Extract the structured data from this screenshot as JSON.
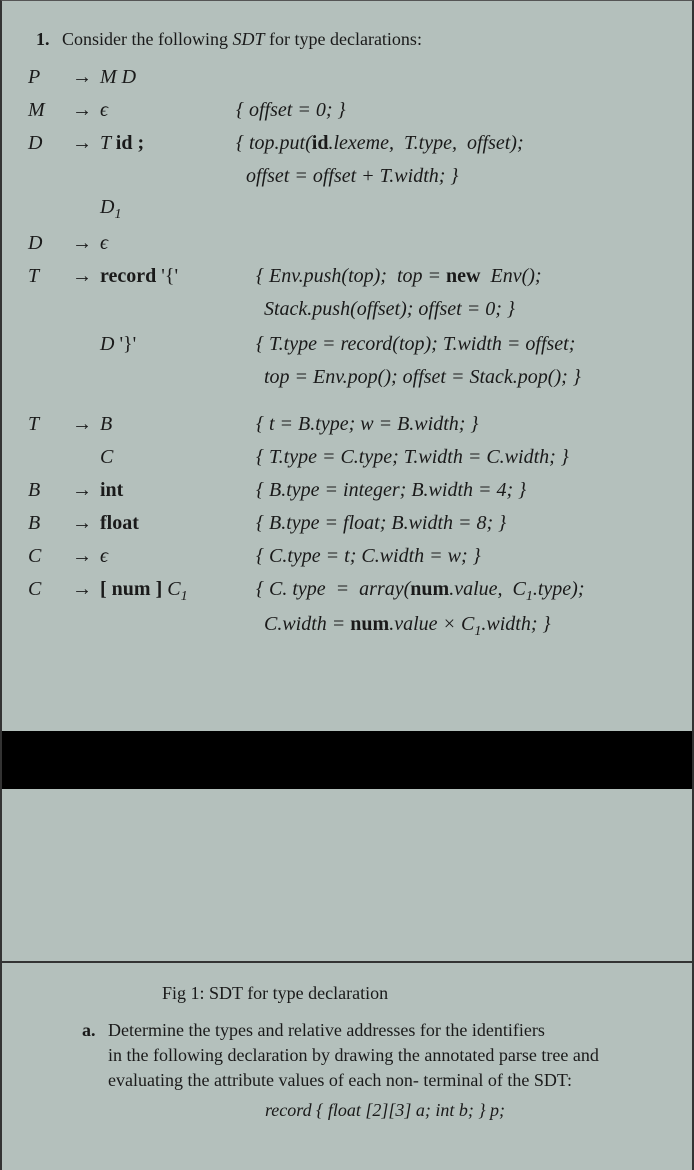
{
  "question": {
    "number": "1.",
    "text_before": "Consider the following ",
    "sdt": "SDT",
    "text_after": " for type declarations:"
  },
  "grammar": {
    "r1": {
      "lhs": "P",
      "arrow": "→",
      "rhs": "M D"
    },
    "r2": {
      "lhs": "M",
      "arrow": "→",
      "rhs": "ϵ",
      "act": "{ offset = 0; }"
    },
    "r3": {
      "lhs": "D",
      "arrow": "→",
      "rhs": "T id ;",
      "act": "{ top.put(id.lexeme,  T.type,  offset);"
    },
    "r3b": {
      "act": "offset  =  offset + T.width; }"
    },
    "r4": {
      "rhs": "D₁"
    },
    "r5": {
      "lhs": "D",
      "arrow": "→",
      "rhs": "ϵ"
    },
    "r6": {
      "lhs": "T",
      "arrow": "→",
      "rhs": "record '{'",
      "act": "{ Env.push(top);  top = new  Env();"
    },
    "r6b": {
      "act": "Stack.push(offset);  offset = 0; }"
    },
    "r7": {
      "rhs": "D '}'",
      "act": "{ T.type = record(top); T.width = offset;"
    },
    "r7b": {
      "act": "top = Env.pop(); offset = Stack.pop(); }"
    },
    "r8": {
      "lhs": "T",
      "arrow": "→",
      "rhs": "B",
      "act": "{ t = B.type; w = B.width; }"
    },
    "r9": {
      "rhs": "C",
      "act": "{ T.type = C.type; T.width = C.width; }"
    },
    "r10": {
      "lhs": "B",
      "arrow": "→",
      "rhs": "int",
      "act": "{ B.type = integer;  B.width = 4; }"
    },
    "r11": {
      "lhs": "B",
      "arrow": "→",
      "rhs": "float",
      "act": "{ B.type = float;  B.width = 8; }"
    },
    "r12": {
      "lhs": "C",
      "arrow": "→",
      "rhs": "ϵ",
      "act": "{ C.type = t; C.width = w; }"
    },
    "r13": {
      "lhs": "C",
      "arrow": "→",
      "rhs": "[ num ] C₁",
      "act": "{ C. type  =  array(num.value,  C₁.type);"
    },
    "r13b": {
      "act": "C.width = num.value × C₁.width; }"
    }
  },
  "figure": {
    "caption": "Fig 1: SDT  for type declaration"
  },
  "subquestion": {
    "letter": "a.",
    "line1": "Determine the types  and relative addresses for the identifiers",
    "line2": "in the following declaration by drawing the annotated parse tree and",
    "line3": "evaluating the attribute values of each non- terminal of the SDT:",
    "code": "record { float [2][3] a;  int b;  } p;"
  }
}
